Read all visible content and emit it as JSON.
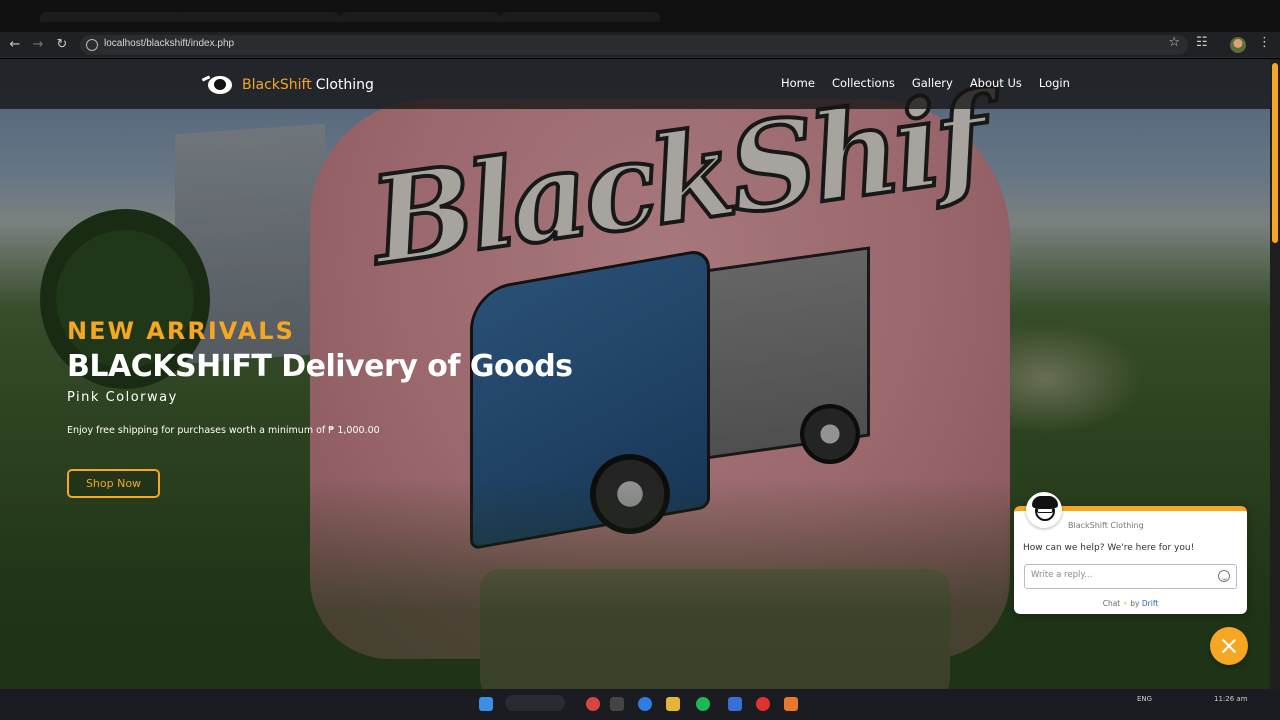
{
  "browser": {
    "url": "localhost/blackshift/index.php"
  },
  "site": {
    "brand_part1": "BlackShift",
    "brand_part2": "Clothing",
    "nav": [
      "Home",
      "Collections",
      "Gallery",
      "About Us",
      "Login"
    ]
  },
  "hero": {
    "kicker": "NEW ARRIVALS",
    "headline": "BLACKSHIFT Delivery of Goods",
    "subtitle": "Pink Colorway",
    "note": "Enjoy free shipping for purchases worth a minimum of ₱ 1,000.00",
    "cta": "Shop Now"
  },
  "chat": {
    "name": "BlackShift Clothing",
    "message": "How can we help? We're here for you!",
    "placeholder": "Write a reply...",
    "footer_prefix": "Chat",
    "footer_by": "by",
    "footer_brand": "Drift"
  },
  "taskbar": {
    "lang": "ENG",
    "time": "11:26 am"
  },
  "colors": {
    "accent": "#f5a623",
    "nav_bg": "#141414",
    "chat_link": "#2b6cb0"
  }
}
